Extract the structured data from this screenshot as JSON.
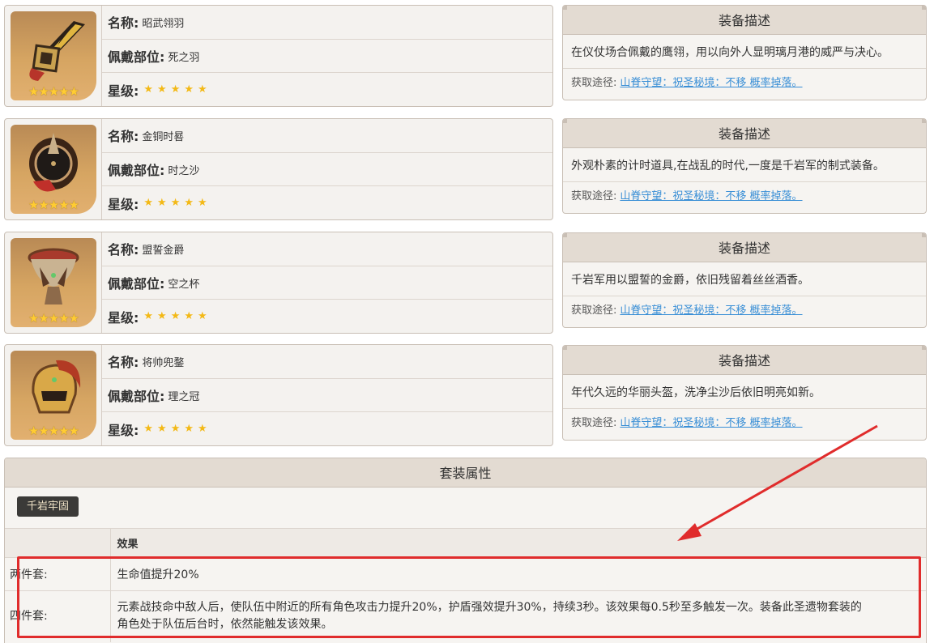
{
  "artifacts": [
    {
      "name_label": "名称:",
      "name": "昭武翎羽",
      "slot_label": "佩戴部位:",
      "slot": "死之羽",
      "rarity_label": "星级:",
      "rarity": "★★★★★",
      "icon": "feather-icon"
    },
    {
      "name_label": "名称:",
      "name": "金铜时晷",
      "slot_label": "佩戴部位:",
      "slot": "时之沙",
      "rarity_label": "星级:",
      "rarity": "★★★★★",
      "icon": "sands-icon"
    },
    {
      "name_label": "名称:",
      "name": "盟誓金爵",
      "slot_label": "佩戴部位:",
      "slot": "空之杯",
      "rarity_label": "星级:",
      "rarity": "★★★★★",
      "icon": "goblet-icon"
    },
    {
      "name_label": "名称:",
      "name": "将帅兜鍪",
      "slot_label": "佩戴部位:",
      "slot": "理之冠",
      "rarity_label": "星级:",
      "rarity": "★★★★★",
      "icon": "circlet-icon"
    }
  ],
  "descriptions": [
    {
      "title": "装备描述",
      "text": "在仪仗场合佩戴的鹰翎，用以向外人显明璃月港的威严与决心。",
      "source_label": "获取途径:",
      "source_link": "山脊守望：祝圣秘境：不移 概率掉落。"
    },
    {
      "title": "装备描述",
      "text": "外观朴素的计时道具,在战乱的时代,一度是千岩军的制式装备。",
      "source_label": "获取途径:",
      "source_link": "山脊守望：祝圣秘境：不移 概率掉落。"
    },
    {
      "title": "装备描述",
      "text": "千岩军用以盟誓的金爵，依旧残留着丝丝酒香。",
      "source_label": "获取途径:",
      "source_link": "山脊守望：祝圣秘境：不移 概率掉落。"
    },
    {
      "title": "装备描述",
      "text": "年代久远的华丽头盔，洗净尘沙后依旧明亮如新。",
      "source_label": "获取途径:",
      "source_link": "山脊守望：祝圣秘境：不移 概率掉落。"
    }
  ],
  "set": {
    "title": "套装属性",
    "tab": "千岩牢固",
    "header_effect": "效果",
    "two_piece_label": "两件套:",
    "two_piece": "生命值提升20%",
    "four_piece_label": "四件套:",
    "four_piece_line1": "元素战技命中敌人后，使队伍中附近的所有角色攻击力提升20%，护盾强效提升30%，持续3秒。该效果每0.5秒至多触发一次。装备此圣遗物套装的",
    "four_piece_line2": "角色处于队伍后台时，依然能触发该效果。"
  },
  "colors": {
    "star": "#ffcc32",
    "link": "#3a8fd6",
    "annotation": "#e02c2c",
    "tab_bg": "#3b3a38"
  }
}
